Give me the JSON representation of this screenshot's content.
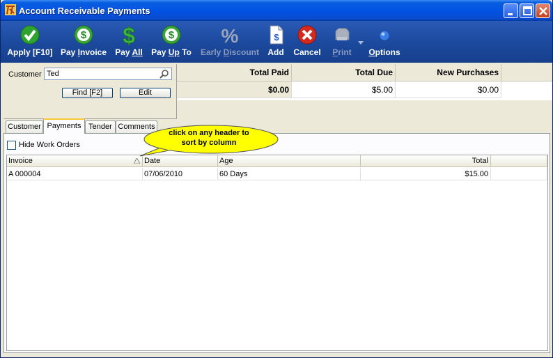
{
  "window": {
    "title": "Account Receivable Payments"
  },
  "toolbar": {
    "apply": "Apply [F10]",
    "pay_invoice_pre": "Pay ",
    "pay_invoice_u": "I",
    "pay_invoice_post": "nvoice",
    "pay_all_pre": "Pay ",
    "pay_all_u": "All",
    "pay_up_to_pre": "Pay ",
    "pay_up_to_u": "Up",
    "pay_up_to_post": " To",
    "early_discount_pre": "Early ",
    "early_discount_u": "D",
    "early_discount_post": "iscount",
    "add": "Add",
    "cancel": "Cancel",
    "print_u": "P",
    "print_post": "rint",
    "options_u": "O",
    "options_post": "ptions"
  },
  "customer": {
    "label": "Customer",
    "value": "Ted",
    "find_label": "Find [F2]",
    "edit_label": "Edit"
  },
  "totals": {
    "headers": [
      "Total Paid",
      "Total Due",
      "New Purchases"
    ],
    "values": [
      "$0.00",
      "$5.00",
      "$0.00"
    ]
  },
  "tabs": [
    "Customer",
    "Payments",
    "Tender",
    "Comments"
  ],
  "active_tab": "Payments",
  "payments": {
    "hide_work_orders_label": "Hide Work Orders",
    "hide_work_orders_checked": false,
    "columns": [
      "Invoice",
      "Date",
      "Age",
      "Total"
    ],
    "rows": [
      {
        "invoice": "A 000004",
        "date": "07/06/2010",
        "age": "60 Days",
        "total": "$15.00"
      }
    ]
  },
  "callout": {
    "line1": "click on any header to",
    "line2": "sort by column"
  },
  "colors": {
    "toolbar": "#1c4a9e",
    "titlebar": "#0054e3",
    "accent_green": "#2fa32f",
    "accent_red": "#d42a1e"
  }
}
